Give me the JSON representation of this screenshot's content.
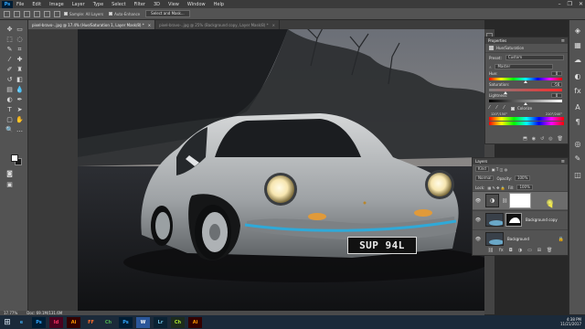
{
  "menubar": {
    "app_logo": "Ps",
    "items": [
      "File",
      "Edit",
      "Image",
      "Layer",
      "Type",
      "Select",
      "Filter",
      "3D",
      "View",
      "Window",
      "Help"
    ],
    "window_controls": [
      "–",
      "❐",
      "✕"
    ]
  },
  "options_bar": {
    "sample_select": "Sample: All Layers",
    "auto_enhance": "Auto-Enhance",
    "select_and_mask": "Select and Mask..."
  },
  "tabs": [
    {
      "label": "pixel-bravo-..jpg @ 17.4% (Hue/Saturation 1, Layer Mask/8) *",
      "active": true,
      "close": "×"
    },
    {
      "label": "pixel-bravo-..jpg @ 25% (Background copy, Layer Mask/8) *",
      "active": false,
      "close": "×"
    }
  ],
  "canvas": {
    "license_plate": "SUP 94L"
  },
  "status": {
    "zoom": "17.77%",
    "doc": "Doc: 69.1M/131.6M"
  },
  "properties": {
    "tab_label": "Properties",
    "menu_icon": "≡",
    "adjustment_title": "Hue/Saturation",
    "preset_label": "Preset:",
    "preset_value": "Custom",
    "channel_value": "Master",
    "hue_label": "Hue:",
    "hue_value": "0",
    "saturation_label": "Saturation:",
    "saturation_value": "-56",
    "lightness_label": "Lightness:",
    "lightness_value": "0",
    "colorize_label": "Colorize",
    "range_left": "120°/150°",
    "range_right": "210°/240°",
    "hue_level": 0.5,
    "saturation_level": 0.22,
    "lightness_level": 0.5
  },
  "layers": {
    "tab_label": "Layers",
    "menu_icon": "≡",
    "kind_label": "Kind",
    "blend_mode": "Normal",
    "opacity_label": "Opacity:",
    "opacity_value": "100%",
    "lock_label": "Lock:",
    "fill_label": "Fill:",
    "fill_value": "100%",
    "items": [
      {
        "name": "",
        "type": "adjustment",
        "selected": true
      },
      {
        "name": "Background copy",
        "type": "image",
        "selected": false
      },
      {
        "name": "Background",
        "type": "image",
        "selected": false
      }
    ]
  },
  "taskbar": {
    "apps": [
      "e",
      "Ps",
      "Id",
      "Ai",
      "Ch",
      "FF",
      "Ps",
      "W",
      "Lr",
      "Ch",
      "Ai"
    ],
    "time": "4:38 PM",
    "date": "11/21/2017"
  },
  "colors": {
    "accent_blue": "#31a8ff",
    "panel_bg": "#535353",
    "menu_bg": "#3b3b3b",
    "taskbar_bg": "#1b2a3a"
  }
}
